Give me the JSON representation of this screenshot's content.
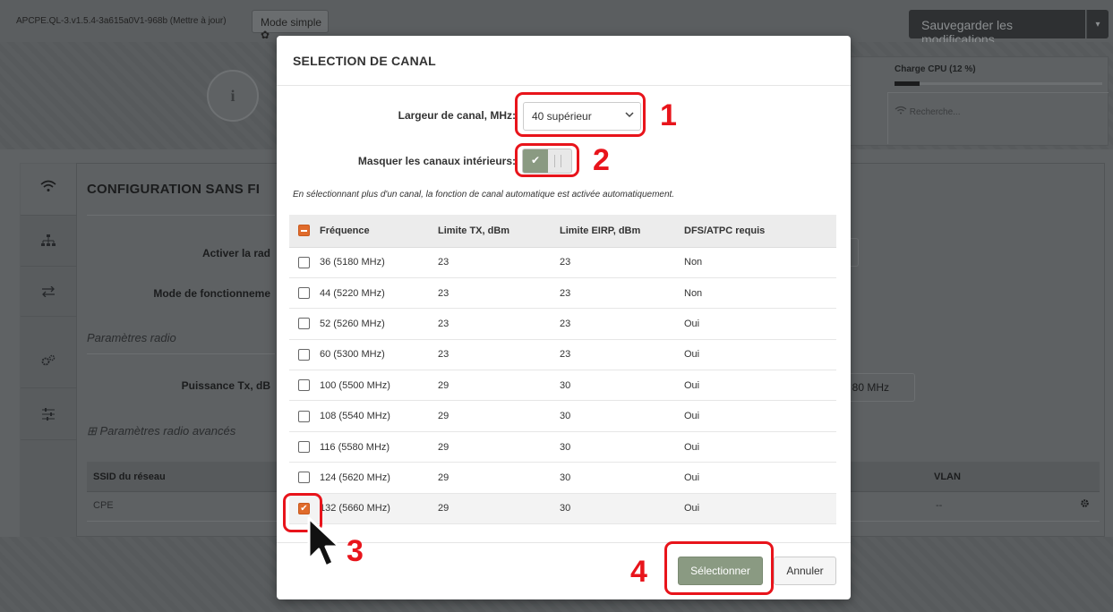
{
  "page": {
    "version_text": "APCPE.QL-3.v1.5.4-3a615a0V1-968b (Mettre à jour)",
    "mode_button": "Mode simple ✿",
    "save_button": "Sauvegarder les modifications",
    "save_caret": "▾",
    "info_icon": "i",
    "cpu_label": "Charge CPU (12 %)",
    "cpu_load_percent": 12,
    "search_text": "Recherche...",
    "section_title": "CONFIGURATION SANS FI",
    "enable_radio_label": "Activer la rad",
    "operation_mode_label": "Mode de fonctionneme",
    "radio_params_label": "Paramètres radio",
    "tx_power_label": "Puissance Tx, dB",
    "advanced_label": "⊞ Paramètres radio avancés",
    "bandwidth_fragment": "/ 80 MHz",
    "ssid_header": "SSID du réseau",
    "vlan_header": "VLAN",
    "ssid_row": "CPE",
    "vlan_row": "--",
    "rail_icons": [
      "wifi-icon",
      "network-icon",
      "transfer-icon",
      "gears-icon",
      "sliders-icon"
    ]
  },
  "modal": {
    "title": "SELECTION DE CANAL",
    "channel_width_label": "Largeur de canal, MHz:",
    "channel_width_value": "40 supérieur",
    "hide_inner_label": "Masquer les canaux intérieurs:",
    "hide_inner_on": true,
    "note": "En sélectionnant plus d'un canal, la fonction de canal automatique est activée automatiquement.",
    "columns": [
      "Fréquence",
      "Limite TX, dBm",
      "Limite EIRP, dBm",
      "DFS/ATPC requis"
    ],
    "rows": [
      {
        "freq": "36 (5180 MHz)",
        "tx": "23",
        "eirp": "23",
        "dfs": "Non",
        "checked": false
      },
      {
        "freq": "44 (5220 MHz)",
        "tx": "23",
        "eirp": "23",
        "dfs": "Non",
        "checked": false
      },
      {
        "freq": "52 (5260 MHz)",
        "tx": "23",
        "eirp": "23",
        "dfs": "Oui",
        "checked": false
      },
      {
        "freq": "60 (5300 MHz)",
        "tx": "23",
        "eirp": "23",
        "dfs": "Oui",
        "checked": false
      },
      {
        "freq": "100 (5500 MHz)",
        "tx": "29",
        "eirp": "30",
        "dfs": "Oui",
        "checked": false
      },
      {
        "freq": "108 (5540 MHz)",
        "tx": "29",
        "eirp": "30",
        "dfs": "Oui",
        "checked": false
      },
      {
        "freq": "116 (5580 MHz)",
        "tx": "29",
        "eirp": "30",
        "dfs": "Oui",
        "checked": false
      },
      {
        "freq": "124 (5620 MHz)",
        "tx": "29",
        "eirp": "30",
        "dfs": "Oui",
        "checked": false
      },
      {
        "freq": "132 (5660 MHz)",
        "tx": "29",
        "eirp": "30",
        "dfs": "Oui",
        "checked": true
      }
    ],
    "select_button": "Sélectionner",
    "cancel_button": "Annuler"
  },
  "annotations": {
    "step1": "1",
    "step2": "2",
    "step3": "3",
    "step4": "4",
    "color": "#e8141b"
  },
  "colors": {
    "accent_green": "#8a9a82",
    "checkbox_orange": "#e06b2b"
  }
}
